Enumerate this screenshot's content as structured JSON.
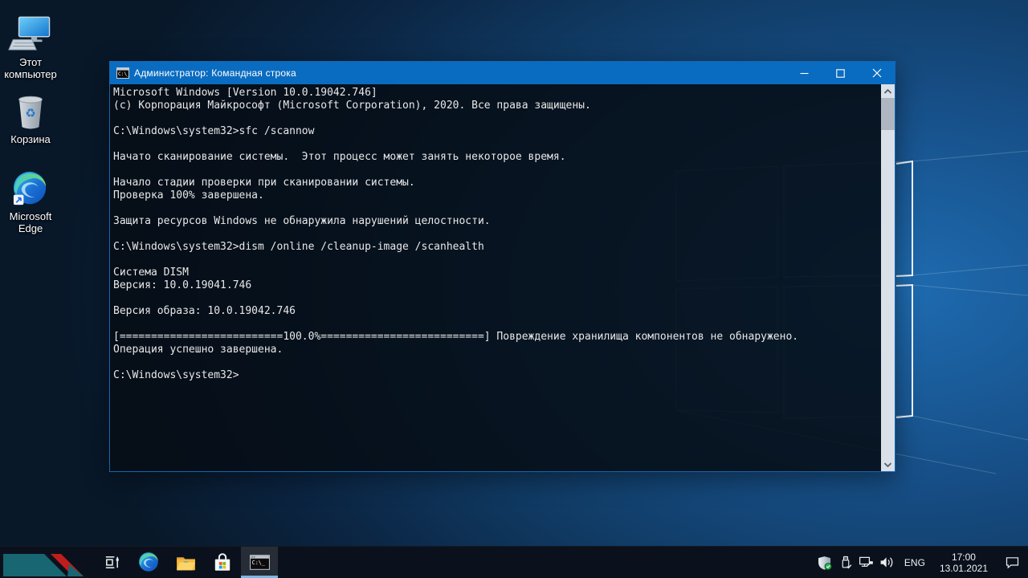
{
  "window": {
    "title": "Администратор: Командная строка",
    "controls": {
      "minimize": "minimize",
      "maximize": "maximize",
      "close": "close"
    }
  },
  "console": {
    "prompt": "C:\\Windows\\system32>",
    "lines": [
      "Microsoft Windows [Version 10.0.19042.746]",
      "(c) Корпорация Майкрософт (Microsoft Corporation), 2020. Все права защищены.",
      "",
      "C:\\Windows\\system32>sfc /scannow",
      "",
      "Начато сканирование системы.  Этот процесс может занять некоторое время.",
      "",
      "Начало стадии проверки при сканировании системы.",
      "Проверка 100% завершена.",
      "",
      "Защита ресурсов Windows не обнаружила нарушений целостности.",
      "",
      "C:\\Windows\\system32>dism /online /cleanup-image /scanhealth",
      "",
      "Система DISM",
      "Версия: 10.0.19041.746",
      "",
      "Версия образа: 10.0.19042.746",
      "",
      "[==========================100.0%==========================] Повреждение хранилища компонентов не обнаружено.",
      "Операция успешно завершена.",
      "",
      "C:\\Windows\\system32>"
    ]
  },
  "desktop": {
    "icons": [
      {
        "name": "this-pc",
        "label": "Этот компьютер"
      },
      {
        "name": "recycle-bin",
        "label": "Корзина"
      },
      {
        "name": "microsoft-edge",
        "label": "Microsoft Edge"
      }
    ]
  },
  "taskbar": {
    "apps": [
      "task-view",
      "edge",
      "file-explorer",
      "store",
      "command-prompt"
    ],
    "active_app": "command-prompt",
    "tray": {
      "language": "ENG",
      "time": "17:00",
      "date": "13.01.2021"
    }
  },
  "colors": {
    "titlebar_blue": "#0a6cc0",
    "console_bg": "#0a131f",
    "taskbar_bg": "#0b111c",
    "active_underline": "#7cb5e5",
    "start_teal": "#176671",
    "start_red": "#c01d1d"
  }
}
